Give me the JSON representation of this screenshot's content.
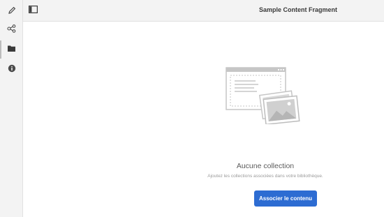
{
  "rail": {
    "items": [
      {
        "icon": "pencil-icon"
      },
      {
        "icon": "share-nodes-icon"
      },
      {
        "icon": "folder-icon"
      },
      {
        "icon": "info-icon"
      }
    ]
  },
  "header": {
    "toggle_icon": "panel-toggle-icon",
    "title": "Sample Content Fragment"
  },
  "empty_state": {
    "illustration": "collection-illustration",
    "title": "Aucune collection",
    "description": "Ajoutez les collections associées dans votre bibliothèque.",
    "button_label": "Associer le contenu"
  },
  "colors": {
    "accent": "#2d6cd2",
    "rail_bg": "#f3f3f3"
  }
}
